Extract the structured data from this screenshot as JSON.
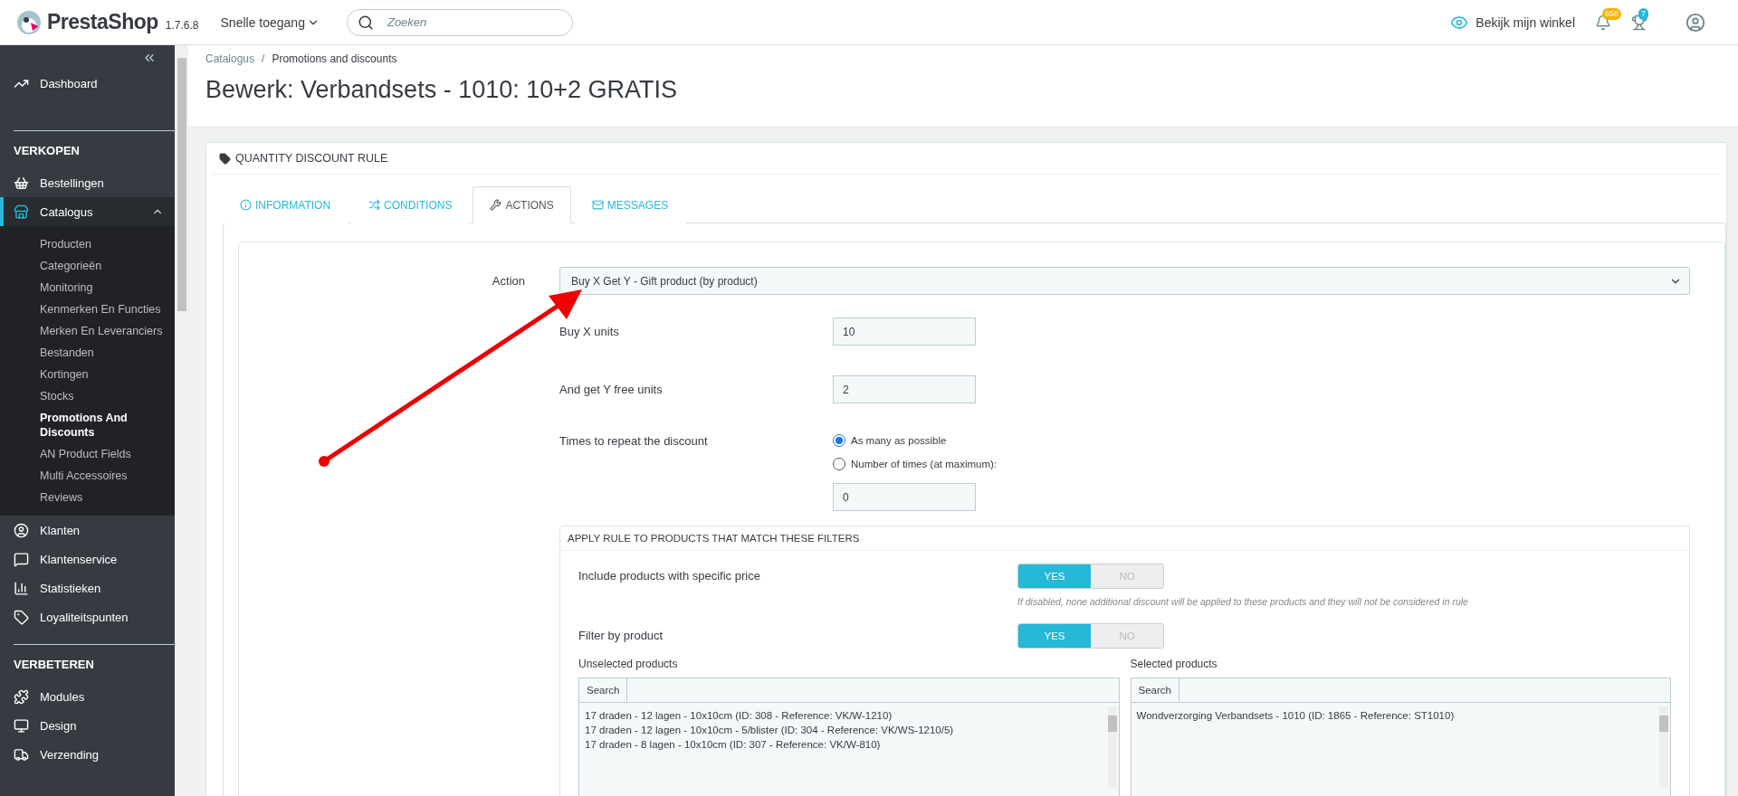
{
  "header": {
    "logo": "PrestaShop",
    "version": "1.7.6.8",
    "quick_access": "Snelle toegang",
    "search": {
      "placeholder": "Zoeken"
    },
    "view_shop": "Bekijk mijn winkel",
    "notifications": "658",
    "trophies": "7"
  },
  "sidebar": {
    "sections": [
      {
        "items": [
          {
            "label": "Dashboard",
            "selected": false
          }
        ]
      },
      {
        "title": "VERKOPEN",
        "items": [
          {
            "label": "Bestellingen",
            "selected": false
          },
          {
            "label": "Catalogus",
            "selected": true,
            "expanded": true,
            "children": [
              {
                "label": "Producten",
                "selected": false
              },
              {
                "label": "Categorieën",
                "selected": false
              },
              {
                "label": "Monitoring",
                "selected": false
              },
              {
                "label": "Kenmerken En Functies",
                "selected": false
              },
              {
                "label": "Merken En Leveranciers",
                "selected": false
              },
              {
                "label": "Bestanden",
                "selected": false
              },
              {
                "label": "Kortingen",
                "selected": false
              },
              {
                "label": "Stocks",
                "selected": false
              },
              {
                "label": "Promotions And Discounts",
                "selected": true
              },
              {
                "label": "AN Product Fields",
                "selected": false
              },
              {
                "label": "Multi Accessoires",
                "selected": false
              },
              {
                "label": "Reviews",
                "selected": false
              }
            ]
          },
          {
            "label": "Klanten",
            "selected": false
          },
          {
            "label": "Klantenservice",
            "selected": false
          },
          {
            "label": "Statistieken",
            "selected": false
          },
          {
            "label": "Loyaliteitspunten",
            "selected": false
          }
        ]
      },
      {
        "title": "VERBETEREN",
        "items": [
          {
            "label": "Modules",
            "selected": false
          },
          {
            "label": "Design",
            "selected": false
          },
          {
            "label": "Verzending",
            "selected": false
          }
        ]
      }
    ]
  },
  "breadcrumb": {
    "items": [
      "Catalogus",
      "Promotions and discounts"
    ],
    "separator": "/"
  },
  "title": "Bewerk: Verbandsets - 1010: 10+2 GRATIS",
  "panel": {
    "title": "QUANTITY DISCOUNT RULE",
    "tabs": [
      {
        "label": "INFORMATION",
        "selected": false
      },
      {
        "label": "CONDITIONS",
        "selected": false
      },
      {
        "label": "ACTIONS",
        "selected": true
      },
      {
        "label": "MESSAGES",
        "selected": false
      }
    ],
    "action": {
      "label": "Action",
      "value": "Buy X Get Y - Gift product (by product)"
    },
    "fields": [
      {
        "label": "Buy X units",
        "value": "10"
      },
      {
        "label": "And get Y free units",
        "value": "2"
      }
    ],
    "repeat": {
      "label": "Times to repeat the discount",
      "options": [
        {
          "label": "As many as possible",
          "selected": true
        },
        {
          "label": "Number of times (at maximum):",
          "selected": false
        }
      ],
      "value": "0"
    },
    "filters": {
      "title": "APPLY RULE TO PRODUCTS THAT MATCH THESE FILTERS",
      "toggles": [
        {
          "label": "Include products with specific price",
          "options": [
            {
              "label": "YES",
              "selected": true
            },
            {
              "label": "NO",
              "selected": false
            }
          ],
          "hint": "If disabled, none additional discount will be applied to these products and they will not be considered in rule"
        },
        {
          "label": "Filter by product",
          "options": [
            {
              "label": "YES",
              "selected": true
            },
            {
              "label": "NO",
              "selected": false
            }
          ]
        }
      ],
      "lists": [
        {
          "label": "Unselected products",
          "search_label": "Search",
          "items": [
            "17 draden - 12 lagen - 10x10cm (ID: 308 - Reference: VK/W-1210)",
            "17 draden - 12 lagen - 10x10cm - 5/blister (ID: 304 - Reference: VK/WS-1210/5)",
            "17 draden - 8 lagen - 10x10cm (ID: 307 - Reference: VK/W-810)"
          ]
        },
        {
          "label": "Selected products",
          "search_label": "Search",
          "items": [
            "Wondverzorging Verbandsets - 1010 (ID: 1865 - Reference: ST1010)"
          ]
        }
      ]
    }
  }
}
